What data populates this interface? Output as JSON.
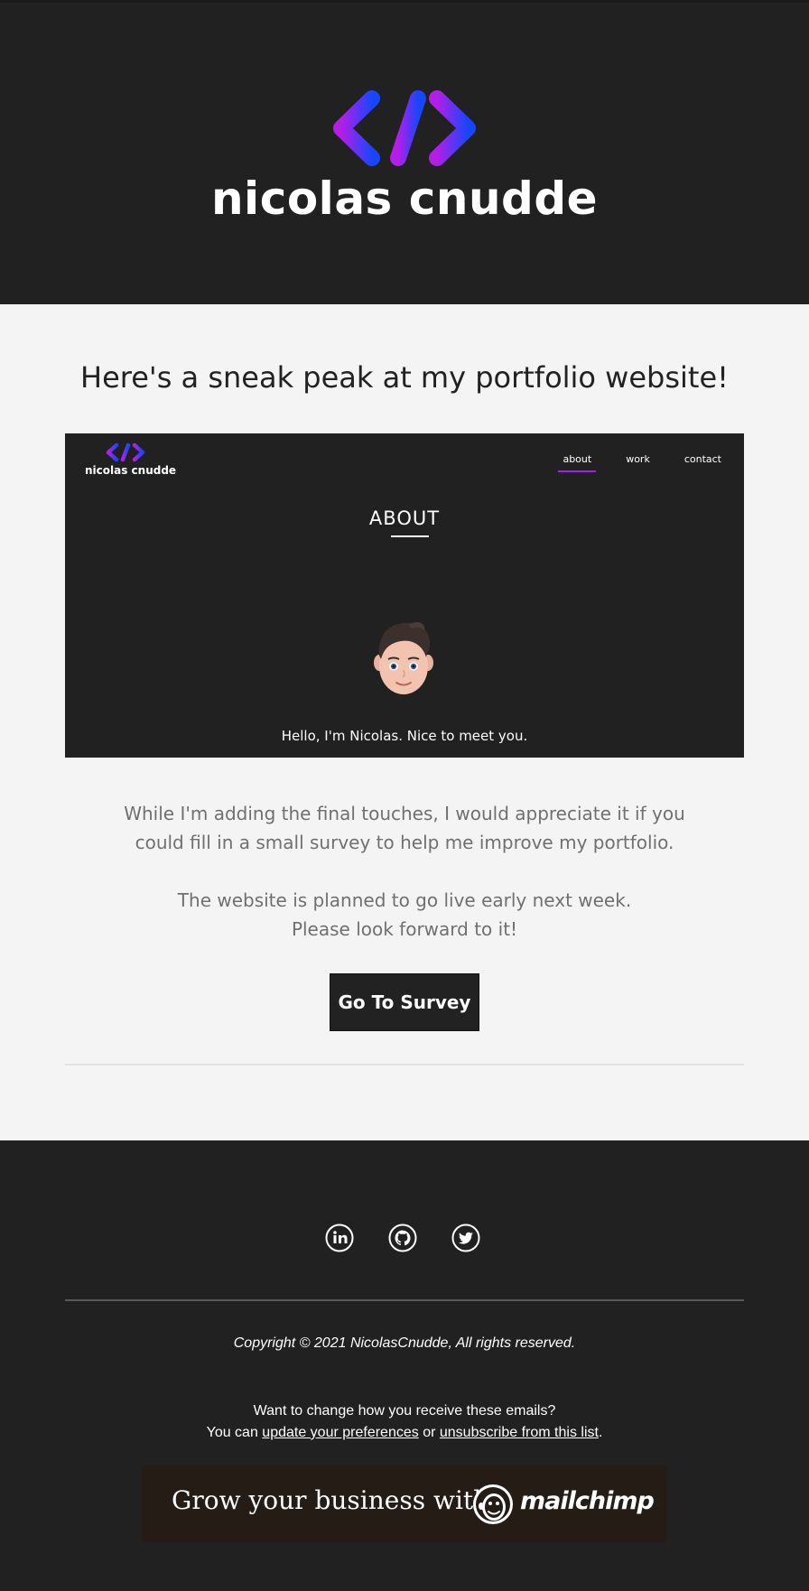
{
  "header": {
    "logo_icon": "code-brackets-icon",
    "name": "nicolas cnudde"
  },
  "main": {
    "headline": "Here's a sneak peak at my portfolio website!",
    "preview": {
      "logo_icon": "code-brackets-icon",
      "name": "nicolas cnudde",
      "nav": [
        "about",
        "work",
        "contact"
      ],
      "active_nav": "about",
      "section_title": "ABOUT",
      "avatar_icon": "memoji-avatar",
      "greeting": "Hello, I'm Nicolas. Nice to meet you."
    },
    "paragraph1": {
      "line1": "While I'm adding the final touches, I would appreciate it if you",
      "line2": "could fill in a small survey to help me improve my portfolio."
    },
    "paragraph2": {
      "line1": "The website is planned to go live early next week.",
      "line2": "Please look forward to it!"
    },
    "cta_label": "Go To Survey"
  },
  "footer": {
    "social": [
      "linkedin-icon",
      "github-icon",
      "twitter-icon"
    ],
    "copyright": "Copyright © 2021 NicolasCnudde, All rights reserved.",
    "manage_line1": "Want to change how you receive these emails?",
    "manage_prefix": "You can ",
    "update_link": "update your preferences",
    "or_text": " or ",
    "unsubscribe_link": "unsubscribe from this list",
    "period": ".",
    "mailchimp_text": "Grow your business with",
    "mailchimp_brand": "mailchimp"
  },
  "colors": {
    "dark_bg": "#212121",
    "light_bg": "#f4f4f4",
    "gradient_start": "#b41ee6",
    "gradient_end": "#1846ff",
    "mailchimp_bg": "#241c15"
  }
}
